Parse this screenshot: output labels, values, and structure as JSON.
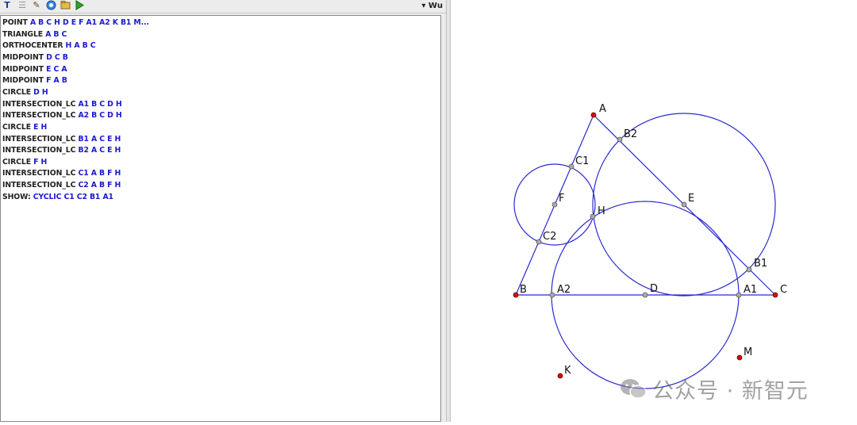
{
  "toolbar": {
    "icons": [
      "text-tool-icon",
      "list-icon",
      "edit-icon",
      "refresh-icon",
      "folder-icon",
      "run-icon"
    ],
    "dropdown_label": "Wu"
  },
  "editor": {
    "lines": [
      {
        "keyword": "POINT",
        "args": "A B C H D E F A1 A2 K B1 M..."
      },
      {
        "keyword": "TRIANGLE",
        "args": "A B C"
      },
      {
        "keyword": "ORTHOCENTER",
        "args": "H A B C"
      },
      {
        "keyword": "MIDPOINT",
        "args": "D C B"
      },
      {
        "keyword": "MIDPOINT",
        "args": "E C A"
      },
      {
        "keyword": "MIDPOINT",
        "args": "F A B"
      },
      {
        "keyword": "CIRCLE",
        "args": "D H"
      },
      {
        "keyword": "INTERSECTION_LC",
        "args": "A1 B C D H"
      },
      {
        "keyword": "INTERSECTION_LC",
        "args": "A2 B C D H"
      },
      {
        "keyword": "CIRCLE",
        "args": "E H"
      },
      {
        "keyword": "INTERSECTION_LC",
        "args": "B1 A C E H"
      },
      {
        "keyword": "INTERSECTION_LC",
        "args": "B2 A C E H"
      },
      {
        "keyword": "CIRCLE",
        "args": "F H"
      },
      {
        "keyword": "INTERSECTION_LC",
        "args": "C1 A B F H"
      },
      {
        "keyword": "INTERSECTION_LC",
        "args": "C2 A B F H"
      },
      {
        "keyword": "SHOW:",
        "args": "CYCLIC C1 C2 B1 A1"
      }
    ]
  },
  "figure": {
    "labels": {
      "A": "A",
      "B": "B",
      "C": "C",
      "H": "H",
      "D": "D",
      "E": "E",
      "F": "F",
      "A1": "A1",
      "A2": "A2",
      "B1": "B1",
      "B2": "B2",
      "C1": "C1",
      "C2": "C2",
      "K": "K",
      "M": "M"
    },
    "colors": {
      "line": "#2a2ad2",
      "free_point": "#cc1111",
      "dependent_point": "#aaaaaa"
    }
  },
  "watermark": {
    "text": "公众号 · 新智元",
    "icon": "wechat-icon"
  }
}
